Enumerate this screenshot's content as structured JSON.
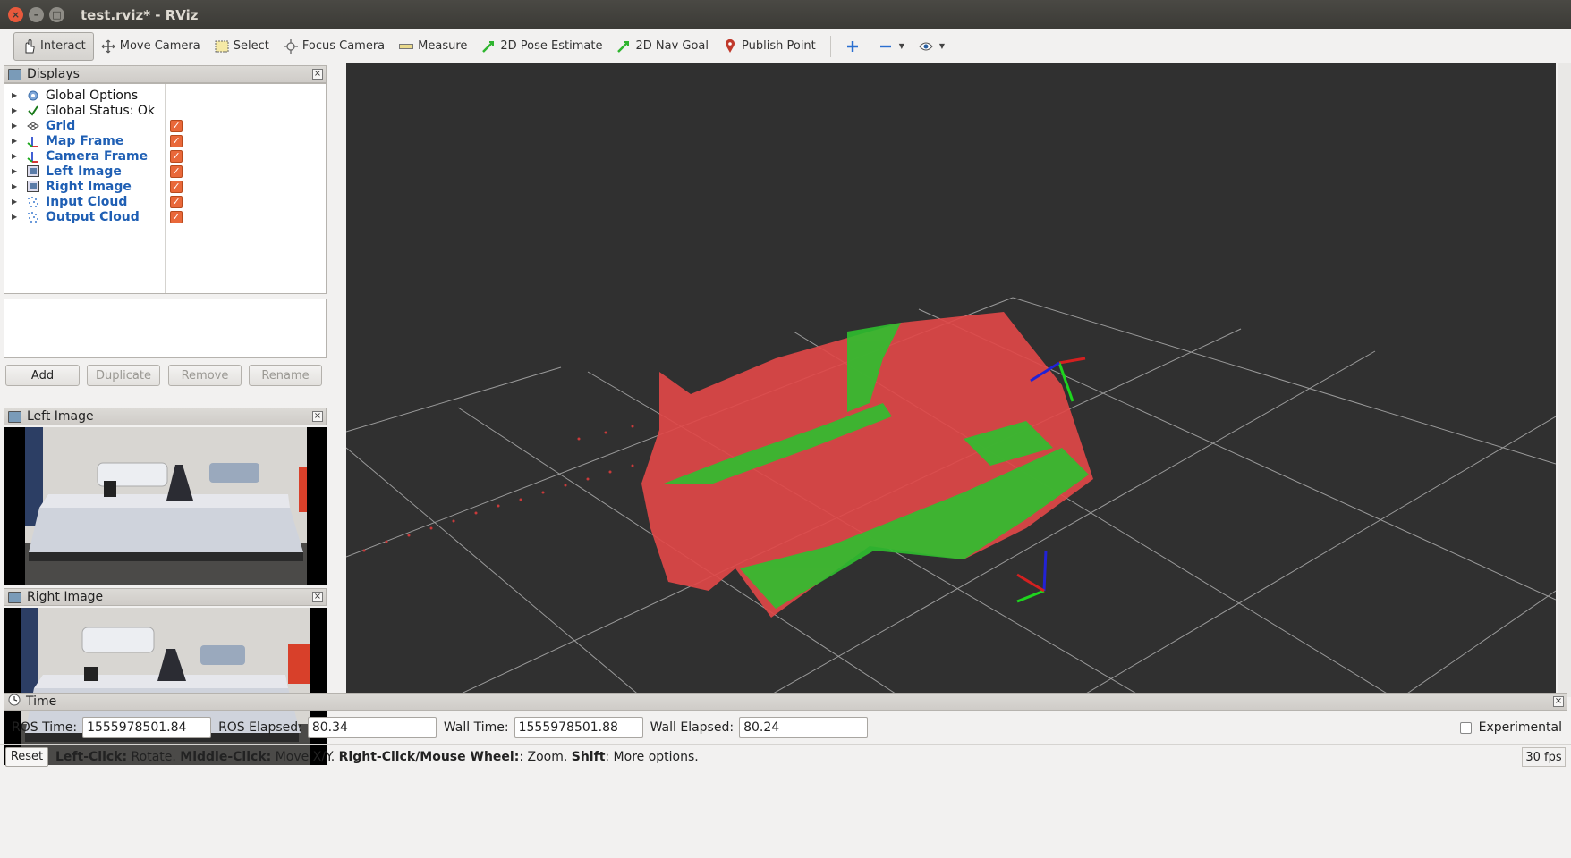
{
  "window": {
    "title": "test.rviz* - RViz"
  },
  "toolbar": {
    "interact": "Interact",
    "move_camera": "Move Camera",
    "select": "Select",
    "focus_camera": "Focus Camera",
    "measure": "Measure",
    "pose_estimate": "2D Pose Estimate",
    "nav_goal": "2D Nav Goal",
    "publish_point": "Publish Point"
  },
  "displays": {
    "title": "Displays",
    "items": [
      {
        "label": "Global Options",
        "icon": "gear-icon",
        "checked": null
      },
      {
        "label": "Global Status: Ok",
        "icon": "check-icon",
        "checked": null
      },
      {
        "label": "Grid",
        "icon": "grid-icon",
        "checked": true
      },
      {
        "label": "Map Frame",
        "icon": "axes-icon",
        "checked": true
      },
      {
        "label": "Camera Frame",
        "icon": "axes-icon",
        "checked": true
      },
      {
        "label": "Left Image",
        "icon": "image-icon",
        "checked": true
      },
      {
        "label": "Right Image",
        "icon": "image-icon",
        "checked": true
      },
      {
        "label": "Input Cloud",
        "icon": "pointcloud-icon",
        "checked": true
      },
      {
        "label": "Output Cloud",
        "icon": "pointcloud-icon",
        "checked": true
      }
    ],
    "buttons": {
      "add": "Add",
      "duplicate": "Duplicate",
      "remove": "Remove",
      "rename": "Rename"
    }
  },
  "left_image": {
    "title": "Left Image"
  },
  "right_image": {
    "title": "Right Image"
  },
  "time": {
    "title": "Time",
    "ros_time_label": "ROS Time:",
    "ros_time": "1555978501.84",
    "ros_elapsed_label": "ROS Elapsed:",
    "ros_elapsed": "80.34",
    "wall_time_label": "Wall Time:",
    "wall_time": "1555978501.88",
    "wall_elapsed_label": "Wall Elapsed:",
    "wall_elapsed": "80.24",
    "experimental": "Experimental"
  },
  "status": {
    "reset": "Reset",
    "h1": "Left-Click:",
    "t1": " Rotate. ",
    "h2": "Middle-Click:",
    "t2": " Move X/Y. ",
    "h3": "Right-Click/Mouse Wheel:",
    "t3": ": Zoom. ",
    "h4": "Shift",
    "t4": ": More options.",
    "fps": "30 fps"
  },
  "colors": {
    "cloud_red": "#e04848",
    "cloud_green": "#2fbf2f",
    "grid": "#9a9a9a",
    "view_bg": "#303030"
  }
}
